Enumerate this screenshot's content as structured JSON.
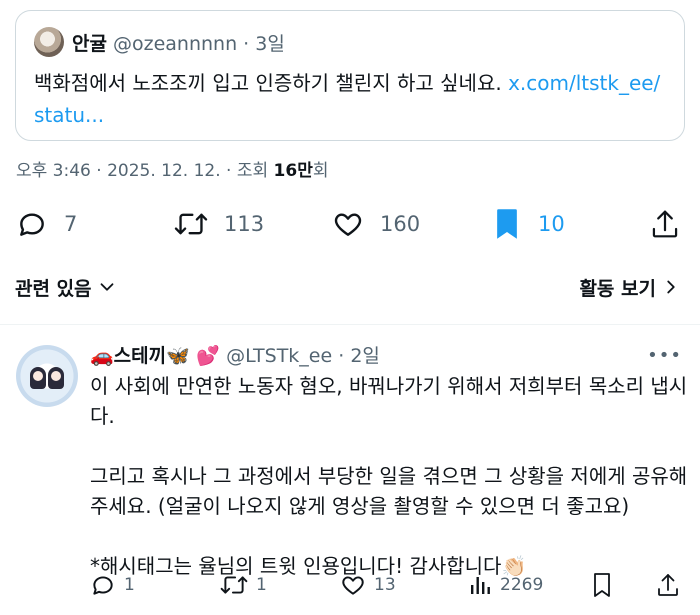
{
  "quote": {
    "name": "안귤",
    "handle": "@ozeannnnn",
    "time": "3일",
    "text": "백화점에서 노조조끼 입고 인증하기 챌린지 하고 싶네요. ",
    "link_line1": "x.com/ltstk_ee/",
    "link_line2": "statu..."
  },
  "meta": {
    "time": "오후 3:46",
    "date": "2025. 12. 12.",
    "views_label": "조회",
    "views_count": "16만",
    "views_suffix": "회"
  },
  "main_actions": {
    "replies": "7",
    "reposts": "113",
    "likes": "160",
    "bookmarks": "10"
  },
  "related": {
    "label": "관련 있음"
  },
  "activity": {
    "label": "활동 보기"
  },
  "reply_tweet": {
    "emoji_prefix": "🚗",
    "name": "스테끼",
    "emoji_suffix": "🦋 💕",
    "handle": "@LTSTk_ee",
    "time": "2일",
    "text": "이 사회에 만연한 노동자 혐오, 바꿔나가기 위해서 저희부터 목소리 냅시다.\n\n그리고 혹시나 그 과정에서 부당한 일을 겪으면 그 상황을 저에게 공유해주세요. (얼굴이 나오지 않게 영상을 촬영할 수 있으면 더 좋고요)\n\n*해시태그는 율님의 트윗 인용입니다! 감사합니다👏🏻",
    "replies": "1",
    "reposts": "1",
    "likes": "13",
    "views": "2269"
  },
  "colors": {
    "accent": "#1d9bf0",
    "secondary_text": "#536471",
    "border": "#cfd9de"
  }
}
